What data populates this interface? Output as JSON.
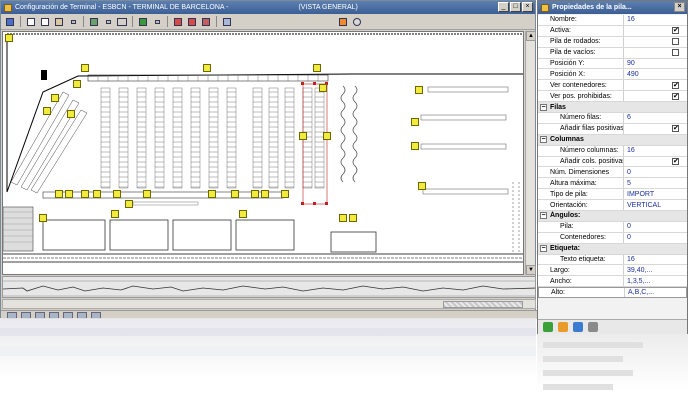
{
  "main_window": {
    "title": "Configuración de Terminal - ESBCN - TERMINAL DE BARCELONA -",
    "title_suffix": "(VISTA GENERAL)",
    "window_buttons": [
      "_",
      "□",
      "×"
    ]
  },
  "toolbar": {
    "buttons": [
      "save-icon",
      "new-icon",
      "copy-icon",
      "paste-icon",
      "dropdown-icon",
      "list-icon",
      "rectangle-icon",
      "color-icon",
      "cut-icon",
      "copy-icon",
      "paste-icon",
      "close-icon",
      "help-icon"
    ]
  },
  "scroll": {
    "up": "▲",
    "down": "▼"
  },
  "properties_panel": {
    "title": "Propiedades de la pila...",
    "close": "×",
    "rows": [
      {
        "type": "prop",
        "key": "Nombre:",
        "value": "16"
      },
      {
        "type": "check",
        "key": "Activa:",
        "checked": true
      },
      {
        "type": "check",
        "key": "Pila de rodados:",
        "checked": false
      },
      {
        "type": "check",
        "key": "Pila de vacíos:",
        "checked": false
      },
      {
        "type": "prop",
        "key": "Posición Y:",
        "value": "90"
      },
      {
        "type": "prop",
        "key": "Posición X:",
        "value": "490"
      },
      {
        "type": "check",
        "key": "Ver contenedores:",
        "checked": true
      },
      {
        "type": "check",
        "key": "Ver pos. prohibidas:",
        "checked": true
      },
      {
        "type": "cat",
        "key": "Filas",
        "toggle": "−"
      },
      {
        "type": "prop",
        "key": "Número filas:",
        "value": "6",
        "sub": true
      },
      {
        "type": "check",
        "key": "Añadir filas positivas:",
        "checked": true,
        "sub": true
      },
      {
        "type": "cat",
        "key": "Columnas",
        "toggle": "−"
      },
      {
        "type": "prop",
        "key": "Número columnas:",
        "value": "16",
        "sub": true
      },
      {
        "type": "check",
        "key": "Añadir cols. positivas:",
        "checked": true,
        "sub": true
      },
      {
        "type": "prop",
        "key": "Núm. Dimensiones",
        "value": "0"
      },
      {
        "type": "prop",
        "key": "Altura máxima:",
        "value": "5"
      },
      {
        "type": "prop",
        "key": "Tipo de pila:",
        "value": "IMPORT"
      },
      {
        "type": "prop",
        "key": "Orientación:",
        "value": "VERTICAL"
      },
      {
        "type": "cat",
        "key": "Ángulos:",
        "toggle": "−"
      },
      {
        "type": "prop",
        "key": "Pila:",
        "value": "0",
        "sub": true
      },
      {
        "type": "prop",
        "key": "Contenedores:",
        "value": "0",
        "sub": true
      },
      {
        "type": "cat",
        "key": "Etiqueta:",
        "toggle": "−"
      },
      {
        "type": "prop",
        "key": "Texto etiqueta:",
        "value": "16",
        "sub": true
      },
      {
        "type": "prop",
        "key": "Largo:",
        "value": "39,40,..."
      },
      {
        "type": "prop",
        "key": "Ancho:",
        "value": "1,3,5,..."
      },
      {
        "type": "prop",
        "key": "Alto:",
        "value": "A,B,C,..."
      }
    ],
    "footer_buttons": [
      {
        "name": "accept-icon",
        "color": "#3aa03a"
      },
      {
        "name": "cancel-icon",
        "color": "#e89a2a"
      },
      {
        "name": "refresh-icon",
        "color": "#3a7ad0"
      },
      {
        "name": "help-icon",
        "color": "#8a8a8a"
      }
    ]
  },
  "colors": {
    "titlebar": "#3b5f95",
    "label_yellow": "#f2ea3c",
    "value_blue": "#1a2fa0",
    "stack_red": "#c02020"
  }
}
